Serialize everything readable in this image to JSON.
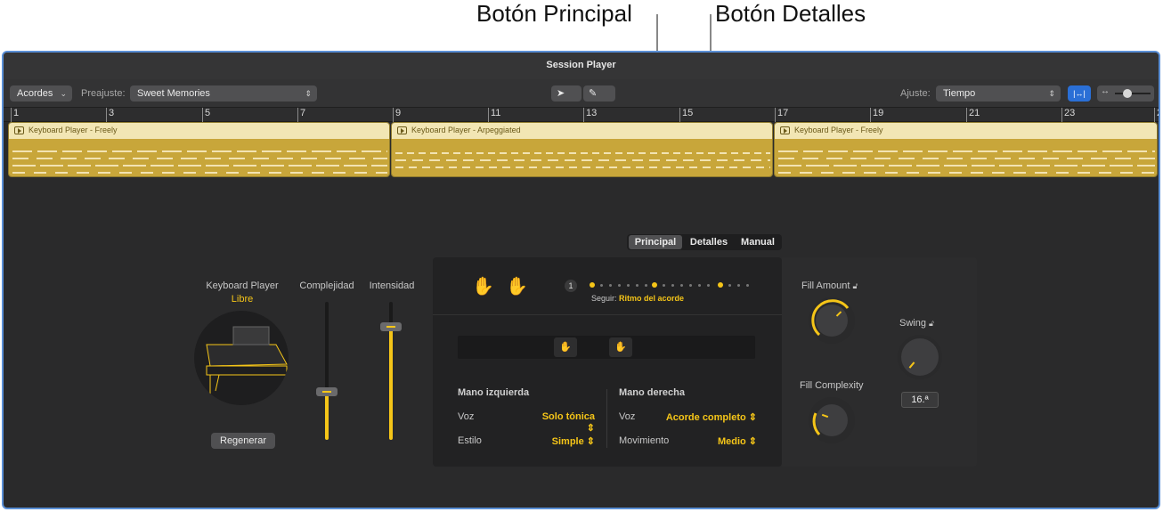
{
  "callouts": {
    "principal": "Botón Principal",
    "detalles": "Botón Detalles"
  },
  "window": {
    "title": "Session Player"
  },
  "toolbar": {
    "type_popup": "Acordes",
    "preset_label": "Preajuste:",
    "preset_value": "Sweet Memories",
    "snap_label": "Ajuste:",
    "snap_value": "Tiempo"
  },
  "ruler": {
    "ticks": [
      "1",
      "3",
      "5",
      "7",
      "9",
      "11",
      "13",
      "15",
      "17",
      "19",
      "21",
      "23",
      "2"
    ]
  },
  "regions": [
    {
      "name": "Keyboard Player - Freely"
    },
    {
      "name": "Keyboard Player - Arpeggiated"
    },
    {
      "name": "Keyboard Player - Freely"
    }
  ],
  "tabs": {
    "principal": "Principal",
    "detalles": "Detalles",
    "manual": "Manual"
  },
  "player": {
    "name": "Keyboard Player",
    "style": "Libre",
    "regen": "Regenerar",
    "complexity_label": "Complejidad",
    "intensity_label": "Intensidad",
    "complexity_level": 0.35,
    "intensity_level": 0.82
  },
  "main": {
    "beat_number": "1",
    "follow_label": "Seguir:",
    "follow_value": "Ritmo del acorde",
    "left_hand": {
      "title": "Mano izquierda",
      "voice_label": "Voz",
      "voice_value": "Solo tónica",
      "style_label": "Estilo",
      "style_value": "Simple"
    },
    "right_hand": {
      "title": "Mano derecha",
      "voice_label": "Voz",
      "voice_value": "Acorde completo",
      "movement_label": "Movimiento",
      "movement_value": "Medio"
    }
  },
  "fills": {
    "amount_label": "Fill Amount",
    "complexity_label": "Fill Complexity",
    "swing_label": "Swing",
    "swing_value": "16.ª"
  },
  "colors": {
    "accent": "#f5c518",
    "region": "#c8a63a",
    "focus": "#5a8fd6"
  }
}
